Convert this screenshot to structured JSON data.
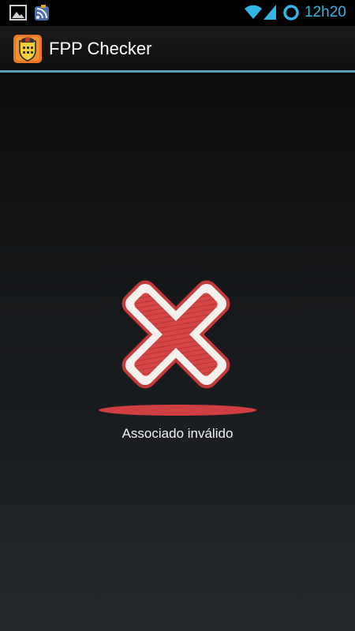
{
  "status_bar": {
    "time": "12h20",
    "accent_color": "#33b5e5",
    "icons": [
      "gallery-icon",
      "rss-icon",
      "wifi-icon",
      "signal-icon",
      "sync-icon"
    ]
  },
  "action_bar": {
    "app_icon": "fpp-logo-icon",
    "title": "FPP Checker",
    "divider_color": "#5b9fbe"
  },
  "result": {
    "icon": "invalid-x-icon",
    "icon_color": "#d64545",
    "message": "Associado inválido"
  }
}
